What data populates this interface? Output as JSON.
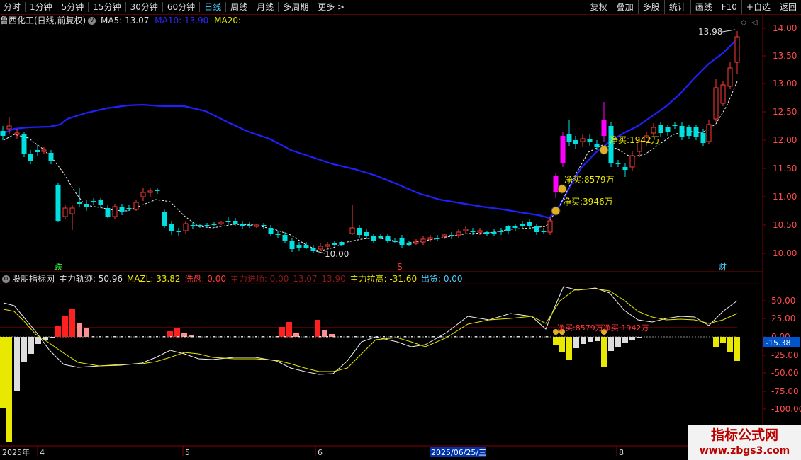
{
  "toolbar": {
    "periods": [
      "分时",
      "1分钟",
      "5分钟",
      "15分钟",
      "30分钟",
      "60分钟",
      "日线",
      "周线",
      "月线",
      "多周期",
      "更多"
    ],
    "active_index": 6,
    "right": [
      "复权",
      "叠加",
      "多股",
      "统计",
      "画线",
      "F10",
      "+自选",
      "返回"
    ]
  },
  "main": {
    "stock_title": "鲁西化工(日线,前复权)",
    "ma5": "MA5: 13.07",
    "ma10": "MA10: 13.90",
    "ma20": "MA20:",
    "price_axis": [
      "14.00",
      "13.50",
      "13.00",
      "12.50",
      "12.00",
      "11.50",
      "11.00",
      "10.50",
      "10.00"
    ],
    "high_label": "13.98",
    "low_label": "10.00",
    "net_buy_1": "净买:3946万",
    "net_buy_2": "净买:8579万",
    "net_buy_3": "净买:1942万",
    "marker_die": "跌",
    "marker_s": "S",
    "marker_cai": "财"
  },
  "sub": {
    "title": "股朋指标网",
    "zhuli_guiji": "主力轨迹: 50.96",
    "mazl": "MAZL: 33.82",
    "xipan": "洗盘: 0.00",
    "jinchang": "主力进场: 0.00",
    "v1": "13.07",
    "v2": "13.90",
    "lagao": "主力拉高: -31.60",
    "chuhuo": "出货: 0.00",
    "axis": [
      "50.00",
      "25.00",
      "0.00",
      "-25.00",
      "-50.00",
      "-75.00",
      "-100.00"
    ],
    "current_value": "-15.38",
    "overlay": "净买:8579万净买:1942万"
  },
  "xaxis": {
    "labels": [
      "2025年",
      "4",
      "5",
      "6",
      "8"
    ],
    "cursor_date": "2025/06/25/三"
  },
  "watermark": {
    "line1": "指标公式网",
    "line2": "www.zbgs3.com"
  },
  "colors": {
    "up": "#ff3c3c",
    "down": "#00e0e0",
    "ma10": "#2020ff",
    "magenta": "#ff00ff",
    "yellow": "#e8e800"
  }
}
